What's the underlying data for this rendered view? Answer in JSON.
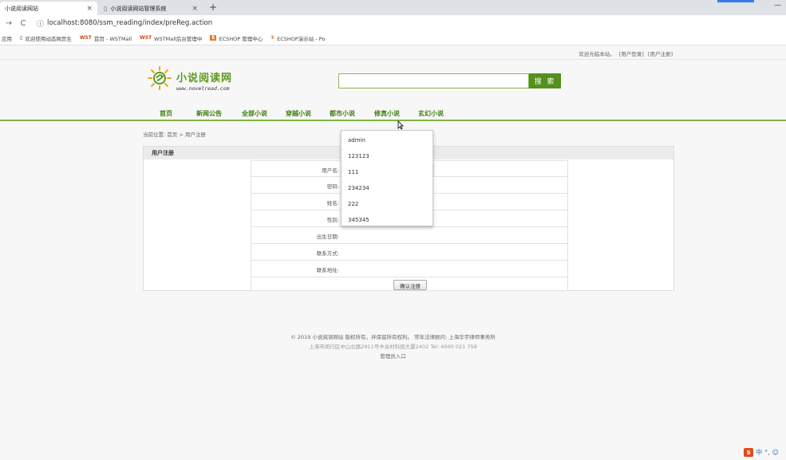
{
  "browser": {
    "tabs": [
      {
        "title": "小说阅读网站",
        "active": true
      },
      {
        "title": "小说阅读网站管理系统",
        "active": false
      }
    ],
    "new_tab_label": "+",
    "url_host": "localhost",
    "url": "localhost:8080/ssm_reading/index/preReg.action",
    "bookmarks": [
      {
        "icon": "apps-icon",
        "label": "应用"
      },
      {
        "icon": "page-icon",
        "label": "欢迎使用动态网页生"
      },
      {
        "icon": "wst-icon",
        "label": "首页 - WSTMall"
      },
      {
        "icon": "wst-icon",
        "label": "WSTMall后台管理中"
      },
      {
        "icon": "ecshop-icon",
        "label": "ECSHOP 管理中心"
      },
      {
        "icon": "ecshop-cart-icon",
        "label": "ECSHOP演示站 - Po"
      }
    ]
  },
  "site": {
    "welcome_text": "欢迎光临本站。",
    "login_link": "[用户登录]",
    "register_link": "[用户注册]",
    "logo_title": "小说阅读网",
    "logo_subtitle": "www.novelread.com",
    "search_placeholder": "",
    "search_button": "搜 索",
    "nav": [
      "首页",
      "新闻公告",
      "全部小说",
      "穿越小说",
      "都市小说",
      "修真小说",
      "玄幻小说"
    ],
    "breadcrumb": "当前位置: 首页 > 用户注册"
  },
  "register": {
    "panel_title": "用户注册",
    "fields": [
      {
        "label": "用户名:",
        "value": ""
      },
      {
        "label": "密码:",
        "value": ""
      },
      {
        "label": "姓名:",
        "value": ""
      },
      {
        "label": "性别:",
        "value": ""
      },
      {
        "label": "出生日期:",
        "value": ""
      },
      {
        "label": "联系方式:",
        "value": ""
      },
      {
        "label": "联系地址:",
        "value": ""
      }
    ],
    "submit_label": "确认注册",
    "autocomplete": [
      "admin",
      "123123",
      "111",
      "234234",
      "222",
      "345345"
    ]
  },
  "footer": {
    "line1": "© 2019 小说阅读网站 版权所有，并保留所有权利。 常年法律顾问: 上海华宇律师事务所",
    "line2": "上海市闵行区中山北路2911号中关村科技大厦2402 Tel: 4000 021 758",
    "admin_link": "管理员入口"
  },
  "tray": {
    "ime_label": "S",
    "ime_mode": "中"
  },
  "colors": {
    "brand_green": "#53901e",
    "nav_green": "#3f7f10",
    "nav_underline": "#7fb23e"
  }
}
